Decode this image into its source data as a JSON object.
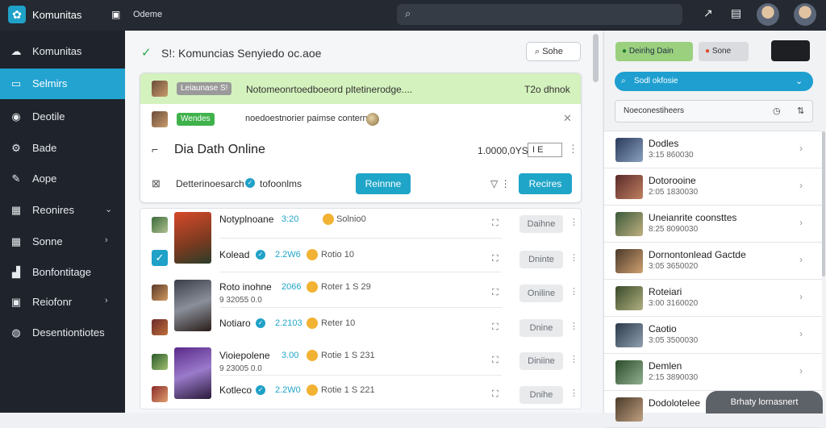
{
  "topbar": {
    "app_name": "Komunitas",
    "doc_icon": "doc-icon",
    "status": "Odeme",
    "search_icon": "search-icon",
    "icons": [
      "share-icon",
      "bag-icon"
    ]
  },
  "sidebar": {
    "items": [
      {
        "label": "Komunitas",
        "icon": "cloud-icon"
      },
      {
        "label": "Selmirs",
        "icon": "window-icon"
      },
      {
        "label": "Deotile",
        "icon": "disc-icon"
      },
      {
        "label": "Bade",
        "icon": "gear-icon"
      },
      {
        "label": "Aope",
        "icon": "chat-icon"
      },
      {
        "label": "Reonires",
        "icon": "panel-icon"
      },
      {
        "label": "Sonne",
        "icon": "grid-icon"
      },
      {
        "label": "Bonfontitage",
        "icon": "chart-icon"
      },
      {
        "label": "Reiofonr",
        "icon": "tv-icon"
      },
      {
        "label": "Desentiontiotes",
        "icon": "record-icon"
      }
    ]
  },
  "main": {
    "header_title": "S!: Komuncias Senyiedo oc.aoe",
    "header_button": "Sohe",
    "card": {
      "banner_tag": "Leiaunase S!",
      "banner_text": "Notomeonrtoedboeord pltetinerodge....",
      "banner_time": "T2o dhnok",
      "row2_tag": "Wendes",
      "row2_text": "noedoestnorier paimse conterne",
      "title": "Dia Dath Online",
      "number": "1.0000,0YS",
      "box_text": "I E",
      "detail_label": "Detterinoesarch",
      "detail_sub": "tofoonlms",
      "button1": "Reinnne",
      "button2": "Recires"
    },
    "list": [
      {
        "name": "Notyplnoane",
        "score": "3:20",
        "text": "Solnio0",
        "sub": "",
        "action": "Daihne"
      },
      {
        "name": "Kolead",
        "score": "2.2W6",
        "text": "Rotio 10",
        "sub": "",
        "action": "Dninte"
      },
      {
        "name": "Roto inohne",
        "score": "2066",
        "text": "Roter 1 S 29",
        "sub": "9 32055 0.0",
        "action": "Oniline"
      },
      {
        "name": "Notiaro",
        "score": "2.2103",
        "text": "Reter 10",
        "sub": "",
        "action": "Dnine"
      },
      {
        "name": "Vioiepolene",
        "score": "3.00",
        "text": "Rotie 1 S 231",
        "sub": "9 23005 0.0",
        "action": "Diniine"
      },
      {
        "name": "Kotleco",
        "score": "2.2W0",
        "text": "Rotie 1 S 221",
        "sub": "",
        "action": "Dnihe"
      }
    ]
  },
  "right": {
    "button1": "Deirihg Dain",
    "button2": "Sone",
    "select": "Sodl okfosie",
    "input": "Noeconestiheers",
    "rows": [
      {
        "name": "Dodles",
        "sub": "3:15 860030"
      },
      {
        "name": "Dotorooine",
        "sub": "2:05 1830030"
      },
      {
        "name": "Uneianrite coonsttes",
        "sub": "8:25 8090030"
      },
      {
        "name": "Dornontonlead Gactde",
        "sub": "3:05 3650020"
      },
      {
        "name": "Roteiari",
        "sub": "3:00 3160020"
      },
      {
        "name": "Caotio",
        "sub": "3:05 3500030"
      },
      {
        "name": "Demlen",
        "sub": "2:15 3890030"
      },
      {
        "name": "Dodolotelee",
        "sub": ""
      }
    ]
  },
  "toast": "Brhaty lornasnert"
}
